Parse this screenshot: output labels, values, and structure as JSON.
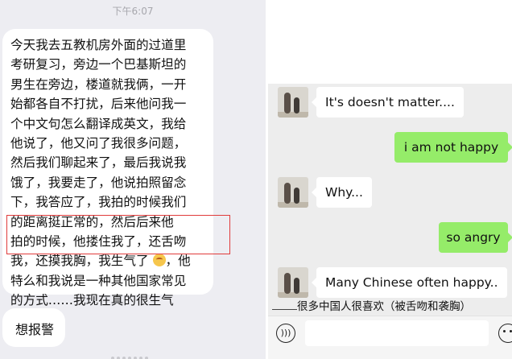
{
  "left_chat": {
    "time": "下午6:07",
    "message_lines": [
      "今天我去五教机房外面的过道里",
      "考研复习，旁边一个巴基斯坦的",
      "男生在旁边，楼道就我俩，一开",
      "始都各自不打扰，后来他问我一",
      "个中文句怎么翻译成英文，我给",
      "他说了，他又问了我很多问题，",
      "然后我们聊起来了，最后我说我",
      "饿了，我要走了，他说拍照留念",
      "下，我答应了，我拍的时候我们",
      "的距离挺正常的，然后后来他",
      "拍的时候，他搂住我了，还舌吻",
      "我，还摸我胸，我生气了",
      "特么和我说是一种其他国家常见",
      "的方式……我现在真的很生气"
    ],
    "line12_suffix": "，他",
    "second_message": "想报警"
  },
  "right_chat": {
    "messages": [
      {
        "side": "left",
        "text": "It's doesn't matter...."
      },
      {
        "side": "right",
        "text": "i am not happy"
      },
      {
        "side": "left",
        "text": "Why..."
      },
      {
        "side": "right",
        "text": "so angry"
      },
      {
        "side": "left",
        "text": "Many Chinese often happy.."
      }
    ],
    "caption": "很多中国人很喜欢（被舌吻和袭胸）",
    "voice_icon": "voice-icon",
    "emoji_icon": "emoji-icon",
    "colors": {
      "sent_bubble": "#95ec69",
      "received_bubble": "#ffffff",
      "highlight": "#e03b3b"
    }
  }
}
